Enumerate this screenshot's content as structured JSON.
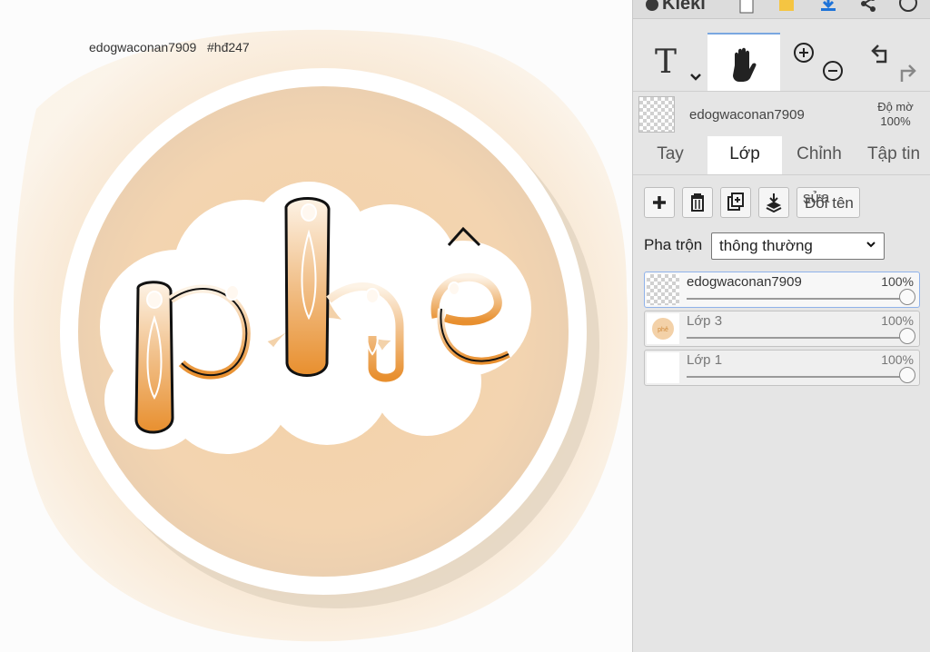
{
  "canvas": {
    "watermark": "edogwaconan7909   #hđ247",
    "artwork_word": "phê",
    "colors": {
      "orange": "#eea95a",
      "cream": "#f6dcb8",
      "ring": "#ffffff"
    }
  },
  "app": {
    "logo": "Kleki"
  },
  "topbar_icons": [
    "new-file-icon",
    "open-folder-icon",
    "download-icon",
    "share-icon",
    "help-icon"
  ],
  "toolbar": {
    "tools": [
      "text-tool-icon",
      "hand-tool-icon",
      "zoom-icon",
      "undo-redo-icon"
    ],
    "text_tool_glyph": "T"
  },
  "layer_header": {
    "name": "edogwaconan7909",
    "opacity_label": "Độ mờ",
    "opacity_value": "100%"
  },
  "tabs": [
    {
      "label": "Tay",
      "active": false
    },
    {
      "label": "Lớp",
      "active": true
    },
    {
      "label": "Chỉnh",
      "active": false
    },
    {
      "label": "Tập tin",
      "active": false
    }
  ],
  "actions": {
    "buttons": [
      "add-layer-icon",
      "delete-layer-icon",
      "duplicate-layer-icon",
      "merge-down-icon"
    ],
    "rename_top": "sửa",
    "rename_label": "Đổi tên"
  },
  "blend": {
    "label": "Pha trộn",
    "value": "thông thường"
  },
  "layers": [
    {
      "name": "edogwaconan7909",
      "opacity": "100%",
      "selected": true
    },
    {
      "name": "Lớp 3",
      "opacity": "100%",
      "selected": false
    },
    {
      "name": "Lớp 1",
      "opacity": "100%",
      "selected": false
    }
  ]
}
